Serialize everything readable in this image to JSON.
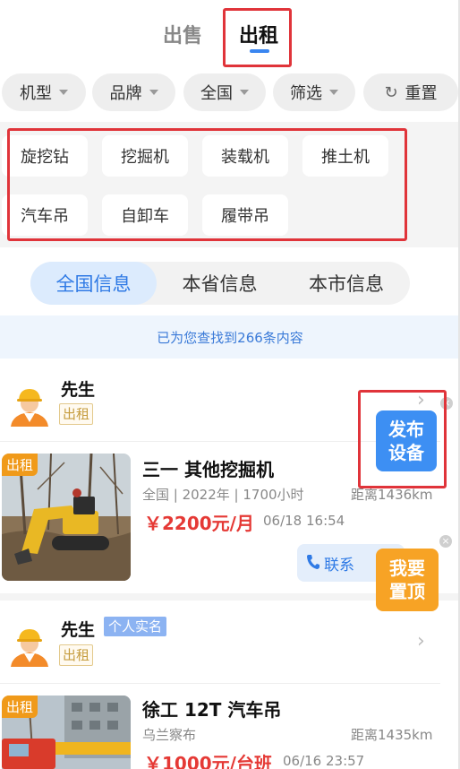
{
  "top_tabs": {
    "sale": "出售",
    "rent": "出租"
  },
  "filters": {
    "model": "机型",
    "brand": "品牌",
    "region": "全国",
    "filter": "筛选",
    "reset": "重置"
  },
  "types": [
    "旋挖钻",
    "挖掘机",
    "装载机",
    "推土机",
    "汽车吊",
    "自卸车",
    "履带吊"
  ],
  "region_tabs": [
    "全国信息",
    "本省信息",
    "本市信息"
  ],
  "result_text": "已为您查找到266条内容",
  "listings": [
    {
      "name": "先生",
      "tag": "出租",
      "verified": "",
      "badge": "出租",
      "title": "三一 其他挖掘机",
      "meta": "全国 | 2022年 | 1700小时",
      "distance": "距离1436km",
      "price": "￥2200元/月",
      "date": "06/18 16:54",
      "contact": "联系"
    },
    {
      "name": "先生",
      "tag": "出租",
      "verified": "个人实名",
      "badge": "出租",
      "title": "徐工 12T 汽车吊",
      "meta": "乌兰察布",
      "distance": "距离1435km",
      "price": "￥1000元/台班",
      "date": "06/16 23:57"
    }
  ],
  "floats": {
    "publish_line1": "发布",
    "publish_line2": "设备",
    "top_line1": "我要",
    "top_line2": "置顶"
  },
  "colors": {
    "accent": "#3a86f0",
    "price": "#e53935",
    "badge": "#f09a1a",
    "highlight": "#e0343a"
  }
}
